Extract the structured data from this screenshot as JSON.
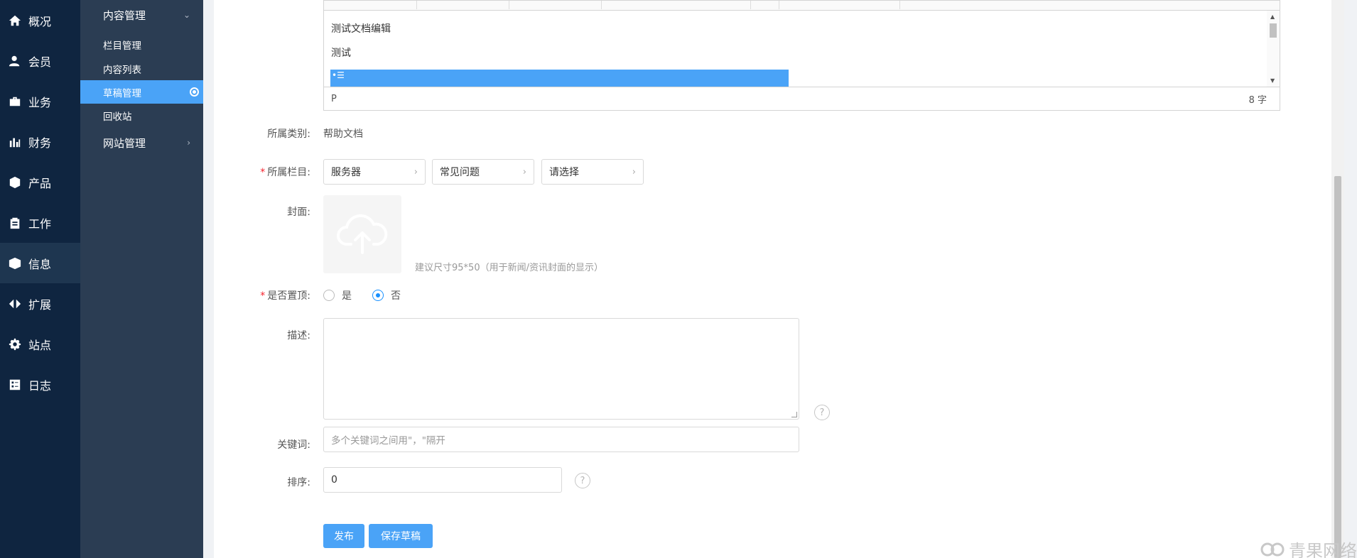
{
  "nav_primary": [
    {
      "label": "概况",
      "icon": "home-icon"
    },
    {
      "label": "会员",
      "icon": "user-icon"
    },
    {
      "label": "业务",
      "icon": "briefcase-icon"
    },
    {
      "label": "财务",
      "icon": "bar-chart-icon"
    },
    {
      "label": "产品",
      "icon": "cube-icon"
    },
    {
      "label": "工作",
      "icon": "clipboard-icon"
    },
    {
      "label": "信息",
      "icon": "box-icon",
      "active": true
    },
    {
      "label": "扩展",
      "icon": "code-icon"
    },
    {
      "label": "站点",
      "icon": "gear-icon"
    },
    {
      "label": "日志",
      "icon": "checklist-icon"
    }
  ],
  "nav_secondary": {
    "group_content": "内容管理",
    "items": [
      "栏目管理",
      "内容列表",
      "草稿管理",
      "回收站"
    ],
    "active_item": "草稿管理",
    "group_site": "网站管理"
  },
  "editor": {
    "lines": [
      "测试文档编辑",
      "测试"
    ],
    "status_left": "P",
    "word_count": "8 字"
  },
  "form": {
    "category": {
      "label": "所属类别:",
      "value": "帮助文档"
    },
    "column": {
      "label": "所属栏目:",
      "selects": [
        "服务器",
        "常见问题",
        "请选择"
      ]
    },
    "cover": {
      "label": "封面:",
      "hint": "建议尺寸95*50（用于新闻/资讯封面的显示）"
    },
    "sticky": {
      "label": "是否置顶:",
      "options": [
        "是",
        "否"
      ],
      "selected": "否"
    },
    "description": {
      "label": "描述:",
      "value": ""
    },
    "keywords": {
      "label": "关键词:",
      "placeholder": "多个关键词之间用\"，\"隔开"
    },
    "sort": {
      "label": "排序:",
      "value": "0"
    },
    "help_glyph": "?"
  },
  "buttons": {
    "publish": "发布",
    "save_draft": "保存草稿"
  },
  "watermark": "青果网络"
}
